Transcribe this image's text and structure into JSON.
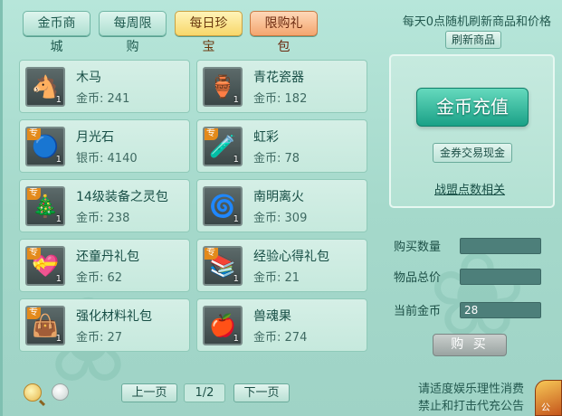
{
  "tabs": [
    {
      "label": "金币商城",
      "state": "normal"
    },
    {
      "label": "每周限购",
      "state": "normal"
    },
    {
      "label": "每日珍宝",
      "state": "active"
    },
    {
      "label": "限购礼包",
      "state": "highlight"
    }
  ],
  "notice": "每天0点随机刷新商品和价格",
  "refresh_button": "刷新商品",
  "items": [
    {
      "name": "木马",
      "currency": "金币",
      "price": "241",
      "qty": "1",
      "tag": "",
      "icon": "wooden-horse-icon",
      "glyph": "🐴"
    },
    {
      "name": "青花瓷器",
      "currency": "金币",
      "price": "182",
      "qty": "1",
      "tag": "",
      "icon": "porcelain-vase-icon",
      "glyph": "🏺"
    },
    {
      "name": "月光石",
      "currency": "银币",
      "price": "4140",
      "qty": "1",
      "tag": "专",
      "icon": "moonstone-icon",
      "glyph": "🔵"
    },
    {
      "name": "虹彩",
      "currency": "金币",
      "price": "78",
      "qty": "1",
      "tag": "专",
      "icon": "iridescent-potion-icon",
      "glyph": "🧪"
    },
    {
      "name": "14级装备之灵包",
      "currency": "金币",
      "price": "238",
      "qty": "1",
      "tag": "专",
      "icon": "equipment-spirit-bag-icon",
      "glyph": "🎄"
    },
    {
      "name": "南明离火",
      "currency": "金币",
      "price": "309",
      "qty": "1",
      "tag": "",
      "icon": "fire-ring-icon",
      "glyph": "🌀"
    },
    {
      "name": "还童丹礼包",
      "currency": "金币",
      "price": "62",
      "qty": "1",
      "tag": "专",
      "icon": "rejuvenation-pill-bag-icon",
      "glyph": "💝"
    },
    {
      "name": "经验心得礼包",
      "currency": "金币",
      "price": "21",
      "qty": "1",
      "tag": "专",
      "icon": "experience-book-bag-icon",
      "glyph": "📚"
    },
    {
      "name": "强化材料礼包",
      "currency": "金币",
      "price": "27",
      "qty": "1",
      "tag": "专",
      "icon": "enhance-material-bag-icon",
      "glyph": "👜"
    },
    {
      "name": "兽魂果",
      "currency": "金币",
      "price": "274",
      "qty": "1",
      "tag": "",
      "icon": "beast-soul-fruit-icon",
      "glyph": "🍎"
    }
  ],
  "recharge_button": "金币充值",
  "exchange_button": "金券交易现金",
  "alliance_link": "战盟点数相关",
  "fields": {
    "buy_quantity_label": "购买数量",
    "buy_quantity_value": "",
    "total_price_label": "物品总价",
    "total_price_value": "",
    "current_gold_label": "当前金币",
    "current_gold_value": "28"
  },
  "buy_button": "购 买",
  "pager": {
    "prev": "上一页",
    "indicator": "1/2",
    "next": "下一页"
  },
  "footer": {
    "line1": "请适度娱乐理性消费",
    "line2": "禁止和打击代充公告"
  },
  "corner_text": "公"
}
